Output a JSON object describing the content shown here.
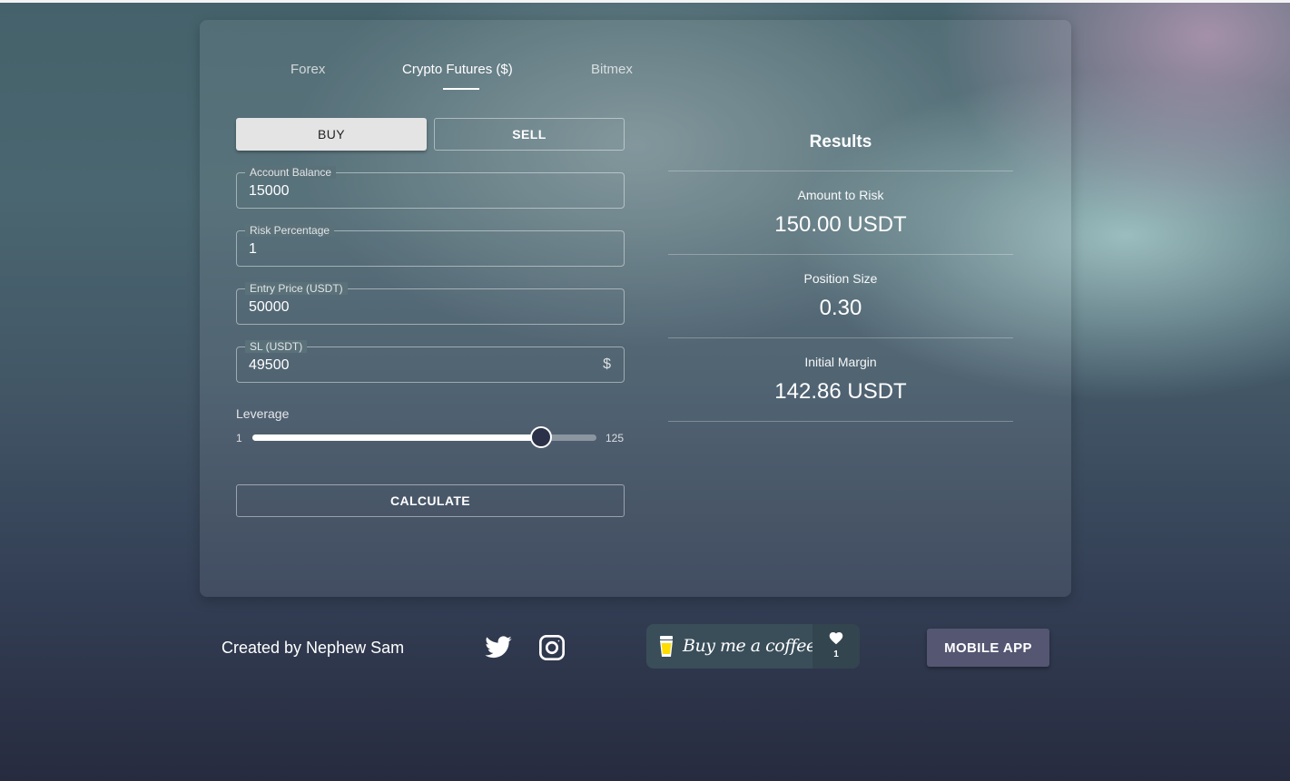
{
  "tabs": [
    {
      "label": "Forex",
      "active": false
    },
    {
      "label": "Crypto Futures ($)",
      "active": true
    },
    {
      "label": "Bitmex",
      "active": false
    }
  ],
  "side_buttons": {
    "buy": "BUY",
    "sell": "SELL",
    "selected": "BUY"
  },
  "fields": [
    {
      "label": "Account Balance",
      "value": "15000"
    },
    {
      "label": "Risk Percentage",
      "value": "1"
    },
    {
      "label": "Entry Price (USDT)",
      "value": "50000"
    },
    {
      "label": "SL (USDT)",
      "value": "49500",
      "suffix": "$"
    }
  ],
  "leverage": {
    "label": "Leverage",
    "min": "1",
    "max": "125",
    "fraction": 0.84
  },
  "calculate_label": "CALCULATE",
  "results": {
    "title": "Results",
    "items": [
      {
        "label": "Amount to Risk",
        "value": "150.00 USDT"
      },
      {
        "label": "Position Size",
        "value": "0.30"
      },
      {
        "label": "Initial Margin",
        "value": "142.86 USDT"
      }
    ]
  },
  "footer": {
    "credit": "Created by Nephew Sam",
    "social_icons": [
      "twitter-icon",
      "instagram-icon"
    ],
    "coffee": {
      "label": "Buy me a coffee",
      "count": "1"
    },
    "mobile_app_label": "MOBILE APP"
  },
  "colors": {
    "accent_dark": "#2b3148",
    "mobile_button": "#545672",
    "buy_button": "#e4e4e4"
  }
}
